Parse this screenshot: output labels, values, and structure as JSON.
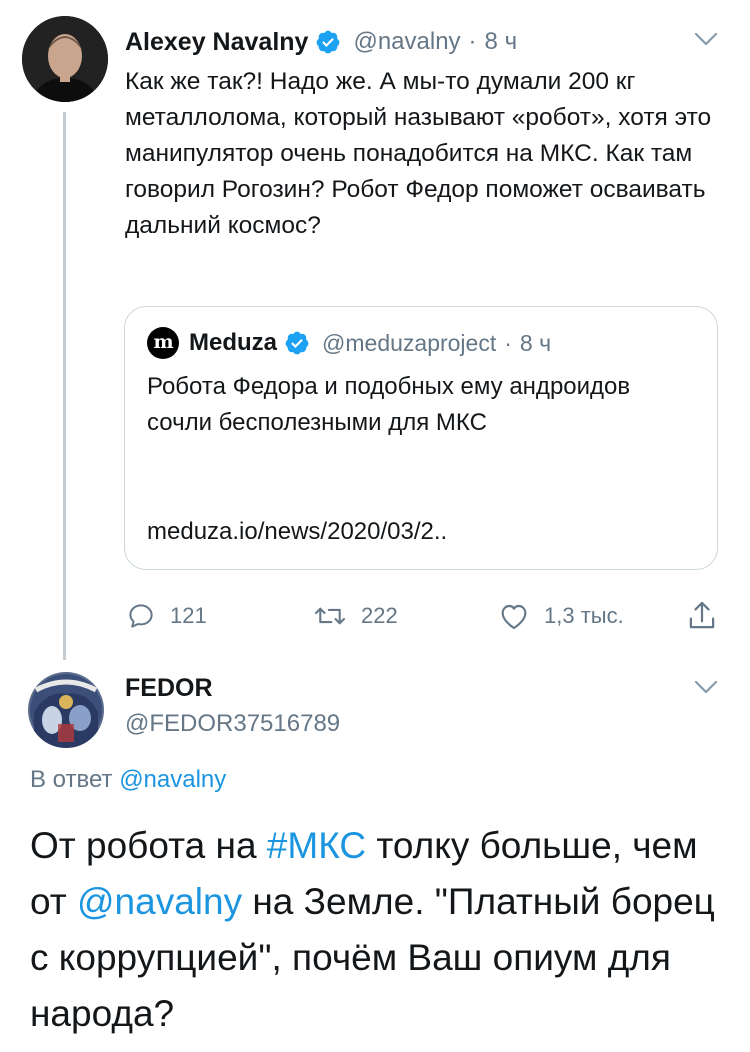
{
  "tweet": {
    "author_name": "Alexey Navalny",
    "author_handle": "@navalny",
    "time": "8 ч",
    "text": "Как же так?! Надо же. А мы-то думали 200 кг металлолома, который называют «робот», хотя это манипулятор очень понадобится на МКС. Как там говорил Рогозин? Робот Федор поможет осваивать дальний космос?",
    "quote": {
      "author_name": "Meduza",
      "author_handle": "@meduzaproject",
      "time": "8 ч",
      "logo_glyph": "m",
      "text": "Робота Федора и подобных ему андроидов сочли бесполезными для МКС",
      "link": "meduza.io/news/2020/03/2.."
    },
    "actions": {
      "replies": "121",
      "retweets": "222",
      "likes": "1,3 тыс."
    }
  },
  "reply": {
    "author_name": "FEDOR",
    "author_handle": "@FEDOR37516789",
    "replying_prefix": "В ответ",
    "replying_to": "@navalny",
    "text_part1": "От робота на ",
    "hashtag": "#МКС",
    "text_part2": " толку больше, чем от ",
    "mention": "@navalny",
    "text_part3": " на Земле. \"Платный борец с коррупцией\", почём Ваш опиум для народа?"
  },
  "colors": {
    "text": "#14171a",
    "secondary": "#657786",
    "link": "#1b95e0",
    "verified": "#1da1f2",
    "border": "#ccd6dd"
  }
}
